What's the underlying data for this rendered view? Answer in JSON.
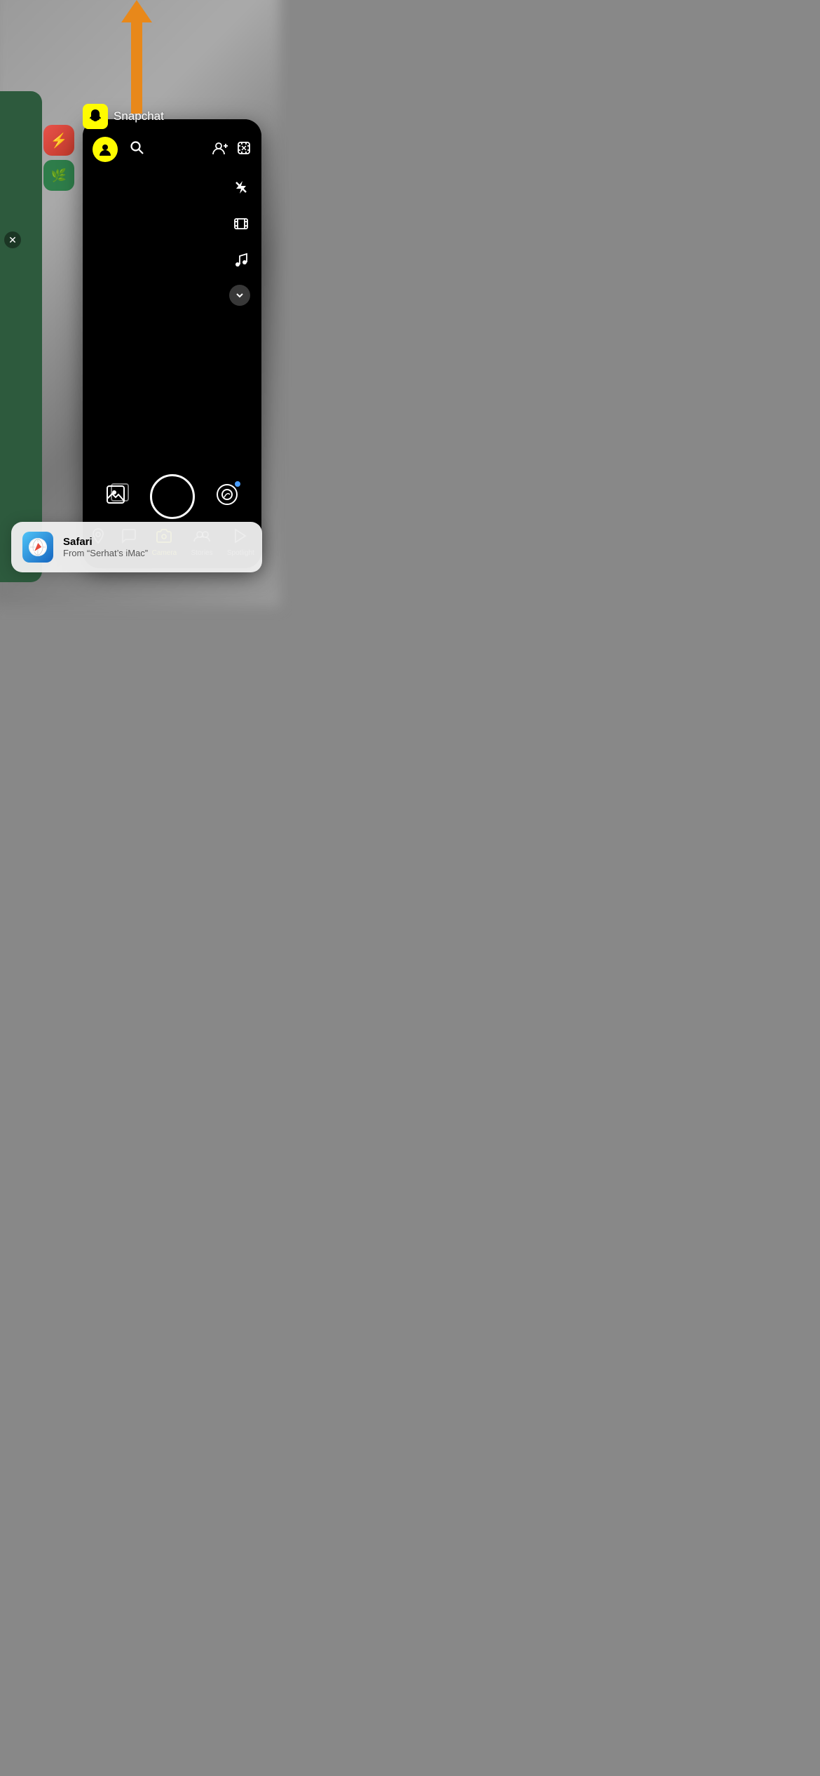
{
  "background": {
    "color": "#888888"
  },
  "arrow": {
    "color": "#e8881a"
  },
  "snapchat": {
    "app_name": "Snapchat",
    "nav": {
      "items": [
        {
          "id": "map",
          "label": "Map",
          "icon": "map",
          "active": false
        },
        {
          "id": "chat",
          "label": "Chat",
          "icon": "chat",
          "active": false
        },
        {
          "id": "camera",
          "label": "Camera",
          "icon": "camera",
          "active": true
        },
        {
          "id": "stories",
          "label": "Stories",
          "icon": "stories",
          "active": false
        },
        {
          "id": "spotlight",
          "label": "Spotlight",
          "icon": "spotlight",
          "active": false
        }
      ]
    },
    "tools": [
      "rotate",
      "flash_off",
      "film",
      "music",
      "more"
    ]
  },
  "notification": {
    "app": "Safari",
    "from": "From “Serhat’s iMac”"
  }
}
